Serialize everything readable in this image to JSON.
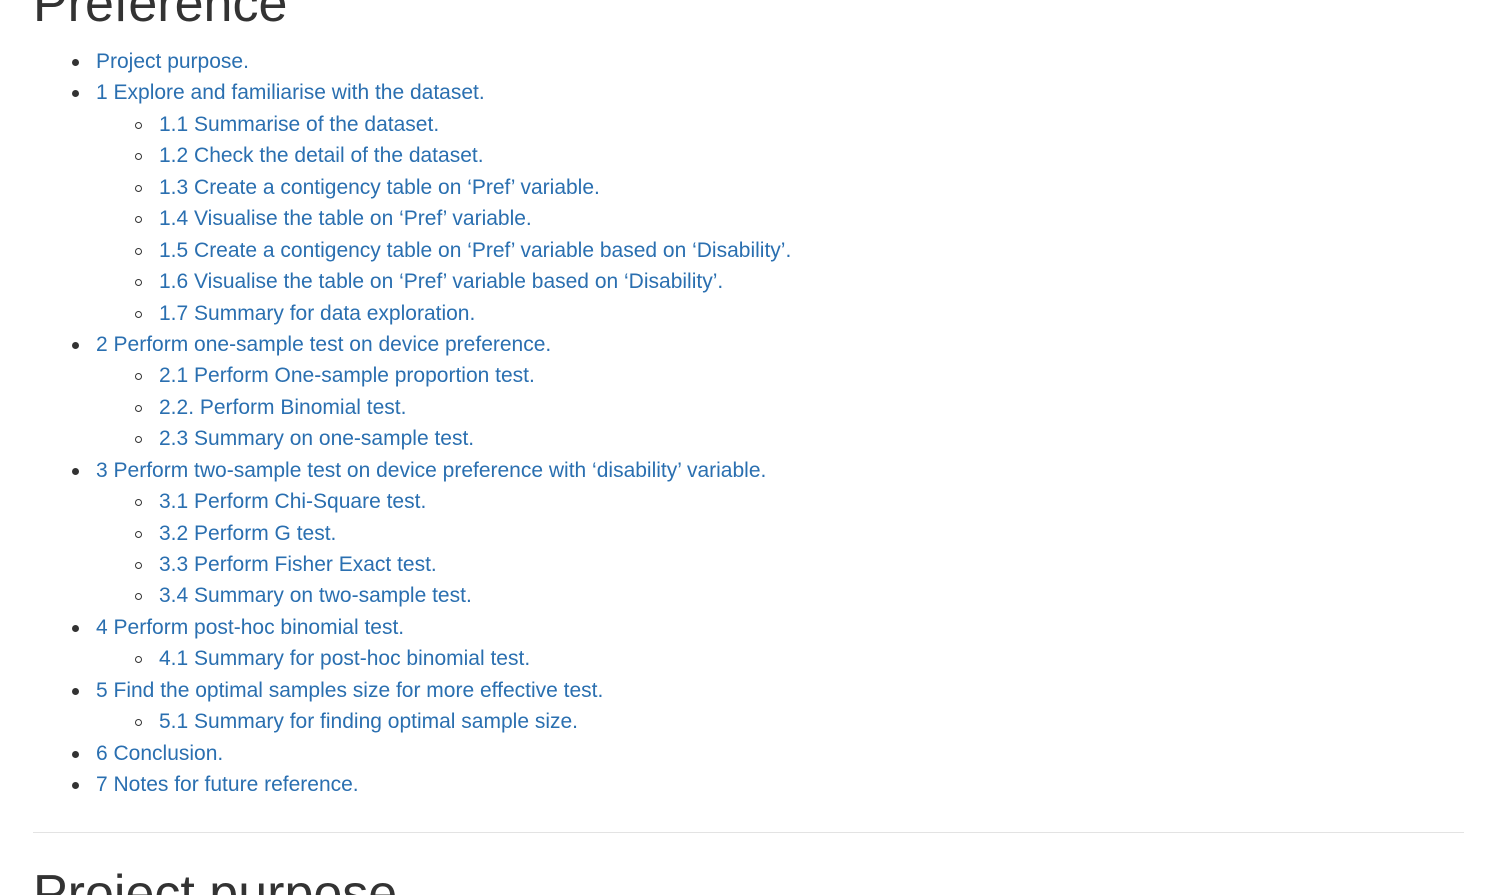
{
  "headings": {
    "top": "Preference",
    "bottom": "Project purpose"
  },
  "toc": [
    {
      "level": 1,
      "label": "Project purpose."
    },
    {
      "level": 1,
      "label": "1 Explore and familiarise with the dataset."
    },
    {
      "level": 2,
      "label": "1.1 Summarise of the dataset."
    },
    {
      "level": 2,
      "label": "1.2 Check the detail of the dataset."
    },
    {
      "level": 2,
      "label": "1.3 Create a contigency table on ‘Pref’ variable."
    },
    {
      "level": 2,
      "label": "1.4 Visualise the table on ‘Pref’ variable."
    },
    {
      "level": 2,
      "label": "1.5 Create a contigency table on ‘Pref’ variable based on ‘Disability’."
    },
    {
      "level": 2,
      "label": "1.6 Visualise the table on ‘Pref’ variable based on ‘Disability’."
    },
    {
      "level": 2,
      "label": "1.7 Summary for data exploration."
    },
    {
      "level": 1,
      "label": "2 Perform one-sample test on device preference."
    },
    {
      "level": 2,
      "label": "2.1 Perform One-sample proportion test."
    },
    {
      "level": 2,
      "label": "2.2. Perform Binomial test."
    },
    {
      "level": 2,
      "label": "2.3 Summary on one-sample test."
    },
    {
      "level": 1,
      "label": "3 Perform two-sample test on device preference with ‘disability’ variable."
    },
    {
      "level": 2,
      "label": "3.1 Perform Chi-Square test."
    },
    {
      "level": 2,
      "label": "3.2 Perform G test."
    },
    {
      "level": 2,
      "label": "3.3 Perform Fisher Exact test."
    },
    {
      "level": 2,
      "label": "3.4 Summary on two-sample test."
    },
    {
      "level": 1,
      "label": "4 Perform post-hoc binomial test."
    },
    {
      "level": 2,
      "label": "4.1 Summary for post-hoc binomial test."
    },
    {
      "level": 1,
      "label": "5 Find the optimal samples size for more effective test."
    },
    {
      "level": 2,
      "label": "5.1 Summary for finding optimal sample size."
    },
    {
      "level": 1,
      "label": "6 Conclusion."
    },
    {
      "level": 1,
      "label": "7 Notes for future reference."
    }
  ],
  "colors": {
    "link": "#2a6fb0",
    "text": "#333333",
    "rule": "#e3e3e3"
  }
}
